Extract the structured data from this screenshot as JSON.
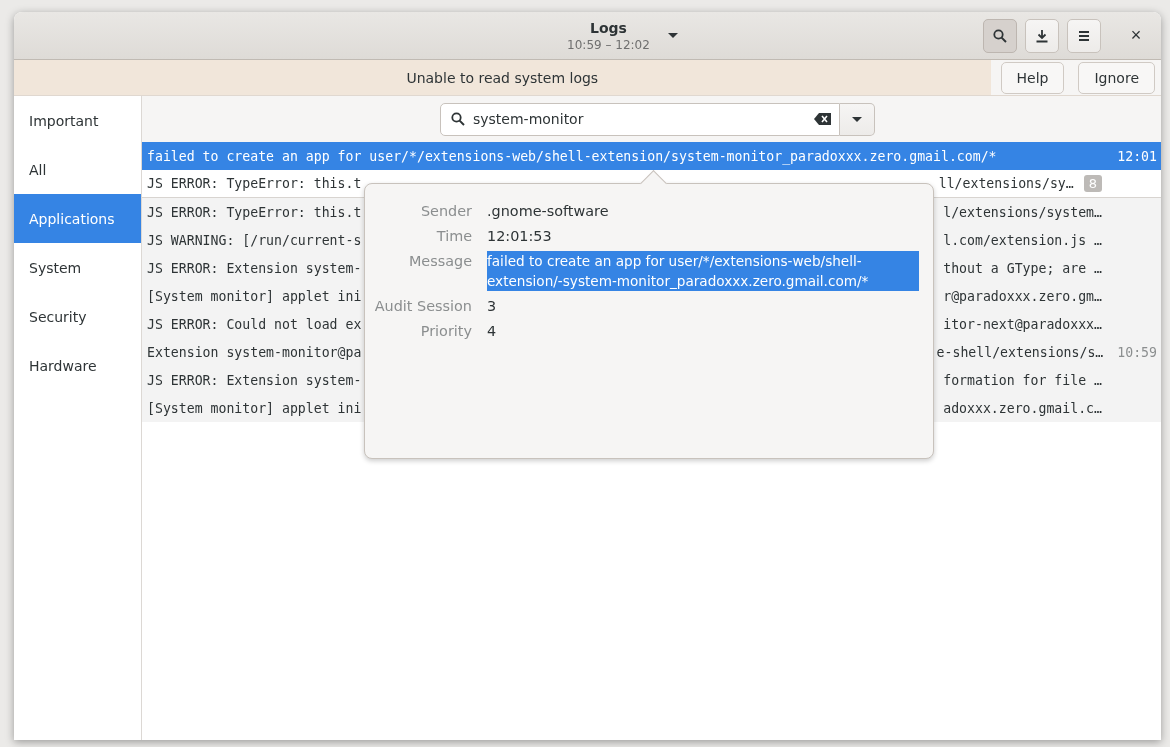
{
  "window": {
    "title": "Logs",
    "subtitle": "10:59 – 12:02"
  },
  "header_buttons": [
    {
      "kind": "search",
      "on": true
    },
    {
      "kind": "download",
      "on": false
    },
    {
      "kind": "menu",
      "on": false
    }
  ],
  "close_button": "×",
  "infobar": {
    "message": "Unable to read system logs",
    "buttons": [
      "Help",
      "Ignore"
    ]
  },
  "sidebar": {
    "items": [
      {
        "label": "Important",
        "selected": false
      },
      {
        "label": "All",
        "selected": false
      },
      {
        "label": "Applications",
        "selected": true
      },
      {
        "label": "System",
        "selected": false
      },
      {
        "label": "Security",
        "selected": false
      },
      {
        "label": "Hardware",
        "selected": false
      }
    ]
  },
  "search": {
    "value": "system-monitor"
  },
  "rows": [
    {
      "text": "failed to create an app for user/*/extensions-web/shell-extension/system-monitor_paradoxxx.zero.gmail.com/*",
      "time": "12:01",
      "selected": true
    },
    {
      "text": "JS ERROR: TypeError: this.t",
      "text_right": "ll/extensions/sy…",
      "count": "8",
      "selected": false,
      "expanded": true
    },
    {
      "text": "JS ERROR: TypeError: this.t",
      "text_right": "l/extensions/system…",
      "selected": false
    },
    {
      "text": "JS WARNING: [/run/current-s",
      "text_right": "l.com/extension.js …",
      "selected": false
    },
    {
      "text": "JS ERROR: Extension system-",
      "text_right": "thout a GType; are …",
      "selected": false
    },
    {
      "text": "[System monitor] applet ini",
      "text_right": "r@paradoxxx.zero.gm…",
      "selected": false
    },
    {
      "text": "JS ERROR: Could not load ex",
      "text_right": "itor-next@paradoxxx…",
      "selected": false
    },
    {
      "text": "Extension system-monitor@pa",
      "text_right": "e-shell/extensions/s…",
      "time": "10:59",
      "selected": false
    },
    {
      "text": "JS ERROR: Extension system-",
      "text_right": "formation for file …",
      "selected": false
    },
    {
      "text": "[System monitor] applet ini",
      "text_right": "adoxxx.zero.gmail.c…",
      "selected": false
    }
  ],
  "details": [
    {
      "label": "Sender",
      "value": ".gnome-software",
      "highlighted": false
    },
    {
      "label": "Time",
      "value": "12:01:53",
      "highlighted": false
    },
    {
      "label": "Message",
      "value": "failed to create an app for user/*/extensions-web/shell-extension/-system-monitor_paradoxxx.zero.gmail.com/*",
      "highlighted": true
    },
    {
      "label": "Audit Session",
      "value": "3",
      "highlighted": false
    },
    {
      "label": "Priority",
      "value": "4",
      "highlighted": false
    }
  ]
}
